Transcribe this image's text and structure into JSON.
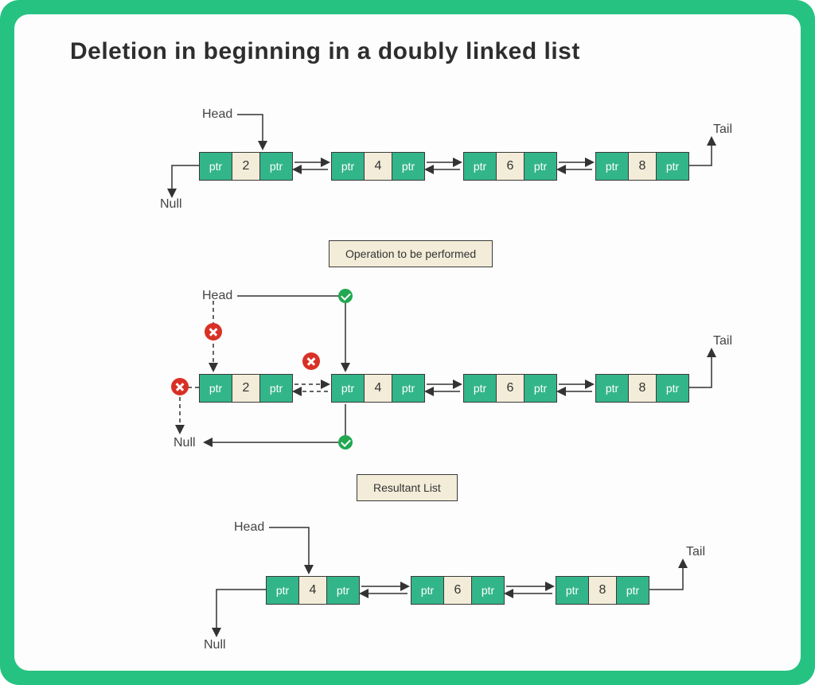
{
  "title": "Deletion in beginning in a doubly linked list",
  "labels": {
    "head": "Head",
    "tail": "Tail",
    "null": "Null",
    "ptr": "ptr",
    "operation": "Operation to be performed",
    "resultant": "Resultant List"
  },
  "diagram": {
    "initial_list": {
      "head_label": "Head",
      "tail_label": "Tail",
      "null_label": "Null",
      "nodes": [
        {
          "prev": "ptr",
          "value": "2",
          "next": "ptr"
        },
        {
          "prev": "ptr",
          "value": "4",
          "next": "ptr"
        },
        {
          "prev": "ptr",
          "value": "6",
          "next": "ptr"
        },
        {
          "prev": "ptr",
          "value": "8",
          "next": "ptr"
        }
      ]
    },
    "operation_step": {
      "caption": "Operation to be performed",
      "removed_links": [
        "old Head -> node 2",
        "node 2 prev -> Null",
        "node 2 <-> node 4"
      ],
      "new_links": [
        "Head -> node 4",
        "node 4 prev -> Null"
      ],
      "nodes": [
        {
          "prev": "ptr",
          "value": "2",
          "next": "ptr",
          "deleted": true
        },
        {
          "prev": "ptr",
          "value": "4",
          "next": "ptr"
        },
        {
          "prev": "ptr",
          "value": "6",
          "next": "ptr"
        },
        {
          "prev": "ptr",
          "value": "8",
          "next": "ptr"
        }
      ]
    },
    "resultant_list": {
      "caption": "Resultant List",
      "nodes": [
        {
          "prev": "ptr",
          "value": "4",
          "next": "ptr"
        },
        {
          "prev": "ptr",
          "value": "6",
          "next": "ptr"
        },
        {
          "prev": "ptr",
          "value": "8",
          "next": "ptr"
        }
      ]
    }
  }
}
